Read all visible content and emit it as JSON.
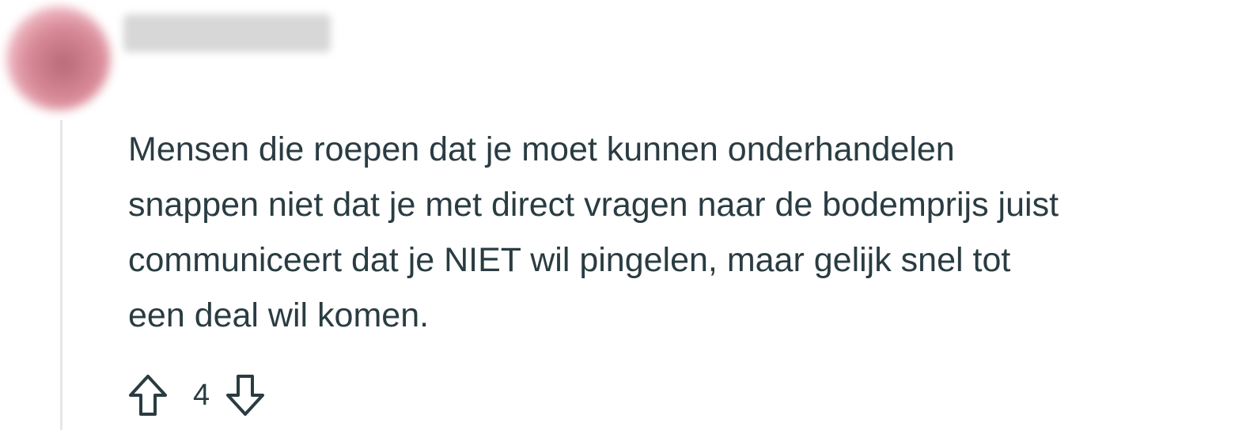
{
  "comment": {
    "body": "Mensen die roepen dat je moet kunnen onderhandelen\nsnappen niet dat je met direct vragen naar de bodemprijs juist\ncommuniceert dat je NIET wil pingelen, maar gelijk snel tot\neen deal wil komen.",
    "vote_count": "4"
  },
  "icons": {
    "upvote": "arrow-up-outline-icon",
    "downvote": "arrow-down-outline-icon"
  },
  "colors": {
    "text": "#2a3c42",
    "thread_line": "#e4e6e8"
  }
}
